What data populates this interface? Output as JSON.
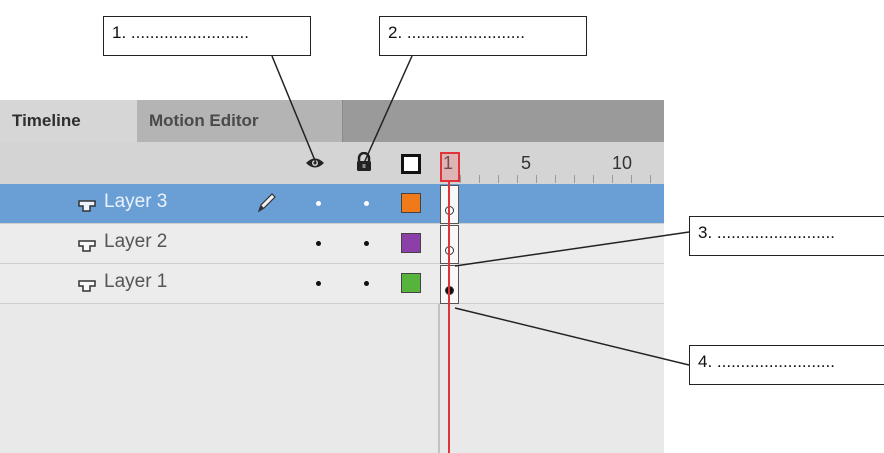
{
  "callouts": [
    {
      "id": "1",
      "text": "1.   ........................."
    },
    {
      "id": "2",
      "text": "2.   ........................."
    },
    {
      "id": "3",
      "text": "3.   ........................."
    },
    {
      "id": "4",
      "text": "4.   ........................."
    }
  ],
  "tabs": [
    {
      "label": "Timeline",
      "active": true
    },
    {
      "label": "Motion Editor",
      "active": false
    }
  ],
  "header": {
    "icons": [
      "eye-icon",
      "lock-icon",
      "outline-square-icon"
    ],
    "frame_numbers": [
      "1",
      "5",
      "10"
    ]
  },
  "layers": [
    {
      "name": "Layer 3",
      "selected": true,
      "pencil": true,
      "color": "#f07a1a",
      "keyframe": "empty"
    },
    {
      "name": "Layer 2",
      "selected": false,
      "pencil": false,
      "color": "#8c3fa8",
      "keyframe": "empty"
    },
    {
      "name": "Layer 1",
      "selected": false,
      "pencil": false,
      "color": "#56b33b",
      "keyframe": "filled"
    }
  ],
  "colors": {
    "playhead": "#e0333a",
    "selected_row": "#6a9fd6",
    "tab_bar": "#9a9a9a"
  }
}
